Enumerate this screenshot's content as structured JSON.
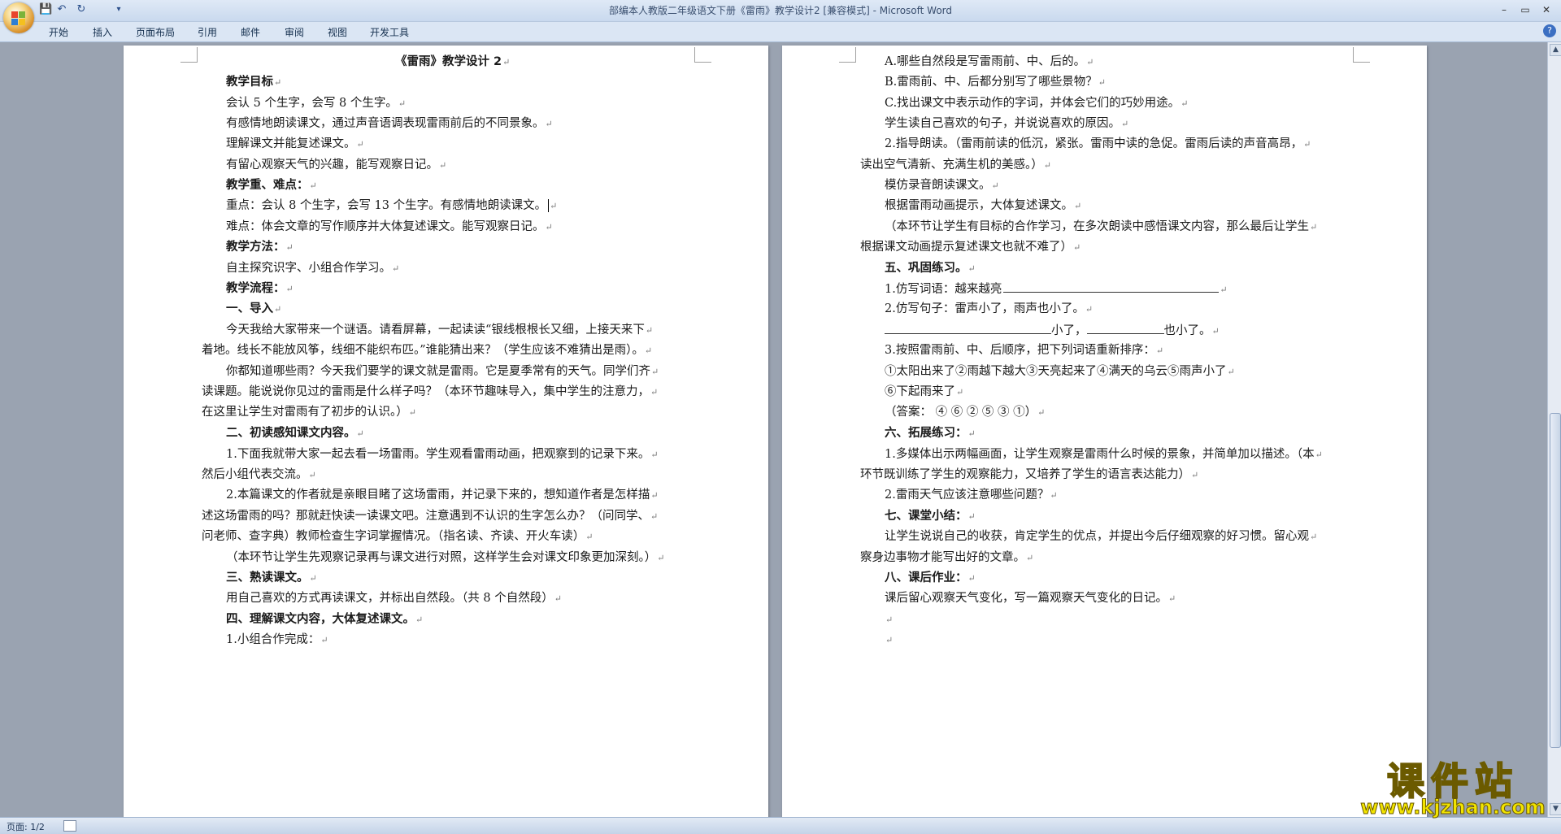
{
  "window": {
    "title": "部编本人教版二年级语文下册《雷雨》教学设计2 [兼容模式] - Microsoft Word",
    "controls": [
      "–",
      "▭",
      "✕"
    ]
  },
  "quick_access": {
    "save": "💾",
    "undo": "↶",
    "redo": "↻",
    "more": "▾"
  },
  "ribbon": {
    "tabs": [
      "开始",
      "插入",
      "页面布局",
      "引用",
      "邮件",
      "审阅",
      "视图",
      "开发工具"
    ],
    "help": "?"
  },
  "page1": {
    "lines": [
      {
        "text": "《雷雨》教学设计 2",
        "bold": true
      },
      {
        "text": "教学目标",
        "bold": true
      },
      {
        "text": "会认 5 个生字，会写 8 个生字。"
      },
      {
        "text": "有感情地朗读课文，通过声音语调表现雷雨前后的不同景象。"
      },
      {
        "text": "理解课文并能复述课文。"
      },
      {
        "text": "有留心观察天气的兴趣，能写观察日记。"
      },
      {
        "text": "教学重、难点：",
        "bold": true
      },
      {
        "text": "重点：会认 8 个生字，会写 13 个生字。有感情地朗读课文。"
      },
      {
        "text": "难点：体会文章的写作顺序并大体复述课文。能写观察日记。"
      },
      {
        "text": "教学方法：",
        "bold": true
      },
      {
        "text": "自主探究识字、小组合作学习。"
      },
      {
        "text": "教学流程：",
        "bold": true
      },
      {
        "text": "一、导入",
        "bold": true
      },
      {
        "text": "今天我给大家带来一个谜语。请看屏幕，一起读读“银线根根长又细，上接天来下"
      },
      {
        "text": "着地。线长不能放风筝，线细不能织布匹。”谁能猜出来？（学生应该不难猜出是雨）。"
      },
      {
        "text": "你都知道哪些雨？今天我们要学的课文就是雷雨。它是夏季常有的天气。同学们齐"
      },
      {
        "text": "读课题。能说说你见过的雷雨是什么样子吗？（本环节趣味导入，集中学生的注意力，"
      },
      {
        "text": "在这里让学生对雷雨有了初步的认识。）"
      },
      {
        "text": "二、初读感知课文内容。",
        "bold": true
      },
      {
        "text": "1.下面我就带大家一起去看一场雷雨。学生观看雷雨动画，把观察到的记录下来。"
      },
      {
        "text": "然后小组代表交流。"
      },
      {
        "text": "2.本篇课文的作者就是亲眼目睹了这场雷雨，并记录下来的，想知道作者是怎样描"
      },
      {
        "text": "述这场雷雨的吗？那就赶快读一读课文吧。注意遇到不认识的生字怎么办？（问同学、"
      },
      {
        "text": "问老师、查字典）教师检查生字词掌握情况。（指名读、齐读、开火车读）"
      },
      {
        "text": "（本环节让学生先观察记录再与课文进行对照，这样学生会对课文印象更加深刻。）"
      },
      {
        "text": "三、熟读课文。",
        "bold": true
      },
      {
        "text": "用自己喜欢的方式再读课文，并标出自然段。（共 8 个自然段）"
      },
      {
        "text": "四、理解课文内容，大体复述课文。",
        "bold": true
      },
      {
        "text": "1.小组合作完成："
      }
    ]
  },
  "page2": {
    "lines": [
      {
        "text": "A.哪些自然段是写雷雨前、中、后的。"
      },
      {
        "text": "B.雷雨前、中、后都分别写了哪些景物？"
      },
      {
        "text": "C.找出课文中表示动作的字词，并体会它们的巧妙用途。"
      },
      {
        "text": "学生读自己喜欢的句子，并说说喜欢的原因。"
      },
      {
        "text": "2.指导朗读。（雷雨前读的低沉，紧张。雷雨中读的急促。雷雨后读的声音高昂，"
      },
      {
        "text": "读出空气清新、充满生机的美感。）"
      },
      {
        "text": "模仿录音朗读课文。"
      },
      {
        "text": "根据雷雨动画提示，大体复述课文。"
      },
      {
        "text": "（本环节让学生有目标的合作学习，在多次朗读中感悟课文内容，那么最后让学生"
      },
      {
        "text": "根据课文动画提示复述课文也就不难了）"
      },
      {
        "text": "五、巩固练习。",
        "bold": true
      },
      {
        "text": "1.仿写词语：越来越亮"
      },
      {
        "text": "2.仿写句子：雷声小了，雨声也小了。"
      },
      {
        "text": "小了，"
      },
      {
        "text": "也小了。"
      },
      {
        "text": "3.按照雷雨前、中、后顺序，把下列词语重新排序："
      },
      {
        "text": "①太阳出来了②雨越下越大③天亮起来了④满天的乌云⑤雨声小了"
      },
      {
        "text": "⑥下起雨来了"
      },
      {
        "text": "（答案： ④ ⑥ ② ⑤ ③ ①）"
      },
      {
        "text": "六、拓展练习：",
        "bold": true
      },
      {
        "text": "1.多媒体出示两幅画面，让学生观察是雷雨什么时候的景象，并简单加以描述。（本"
      },
      {
        "text": "环节既训练了学生的观察能力，又培养了学生的语言表达能力）"
      },
      {
        "text": "2.雷雨天气应该注意哪些问题？"
      },
      {
        "text": "七、课堂小结：",
        "bold": true
      },
      {
        "text": "让学生说说自己的收获，肯定学生的优点，并提出今后仔细观察的好习惯。留心观"
      },
      {
        "text": "察身边事物才能写出好的文章。"
      },
      {
        "text": "八、课后作业：",
        "bold": true
      },
      {
        "text": "课后留心观察天气变化，写一篇观察天气变化的日记。"
      }
    ]
  },
  "paragraph_mark": "↵",
  "status": {
    "page": "页面: 1/2"
  },
  "watermark": {
    "title": "课件站",
    "url": "www.kjzhan.com"
  },
  "colors": {
    "workspace": "#9aa3b1",
    "title_text": "#3a4f6f",
    "watermark": "#f2e400"
  }
}
